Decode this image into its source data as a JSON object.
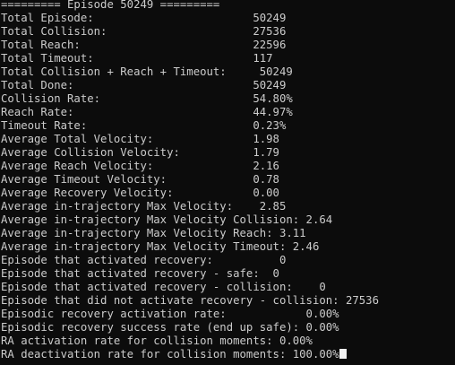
{
  "terminal": {
    "lines": [
      "========= Episode 50249 =========",
      "Total Episode:                        50249",
      "Total Collision:                      27536",
      "Total Reach:                          22596",
      "Total Timeout:                        117",
      "Total Collision + Reach + Timeout:     50249",
      "Total Done:                           50249",
      "Collision Rate:                       54.80%",
      "Reach Rate:                           44.97%",
      "Timeout Rate:                         0.23%",
      "Average Total Velocity:               1.98",
      "Average Collision Velocity:           1.79",
      "Average Reach Velocity:               2.16",
      "Average Timeout Velocity:             0.78",
      "Average Recovery Velocity:            0.00",
      "Average in-trajectory Max Velocity:    2.85",
      "Average in-trajectory Max Velocity Collision: 2.64",
      "Average in-trajectory Max Velocity Reach: 3.11",
      "Average in-trajectory Max Velocity Timeout: 2.46",
      "Episode that activated recovery:          0",
      "Episode that activated recovery - safe:  0",
      "Episode that activated recovery - collision:    0",
      "Episode that did not activate recovery - collision: 27536",
      "Episodic recovery activation rate:            0.00%",
      "Episodic recovery success rate (end up safe): 0.00%",
      "RA activation rate for collision moments: 0.00%",
      "RA deactivation rate for collision moments: 100.00%"
    ],
    "colors": {
      "background": "#0c0c0c",
      "text": "#cccccc",
      "cursor": "#f2f2f2"
    }
  }
}
